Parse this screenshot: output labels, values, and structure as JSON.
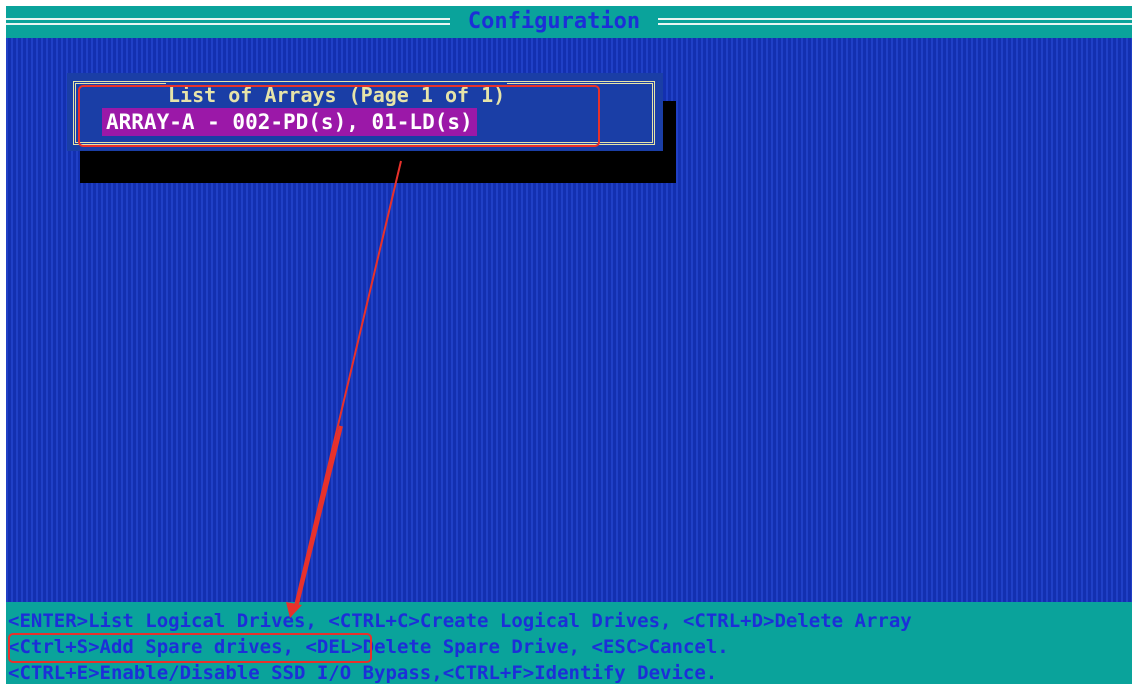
{
  "window": {
    "title": "Configuration"
  },
  "dialog": {
    "title": "List of Arrays (Page 1 of 1)",
    "items": [
      {
        "label": "ARRAY-A - 002-PD(s), 01-LD(s)",
        "selected": true
      }
    ]
  },
  "help": {
    "line1": [
      {
        "key": "<ENTER>",
        "action": "List Logical Drives,"
      },
      {
        "key": "<CTRL+C>",
        "action": "Create Logical Drives,"
      },
      {
        "key": "<CTRL+D>",
        "action": "Delete Array"
      }
    ],
    "line2": [
      {
        "key": "<Ctrl+S>",
        "action": "Add Spare drives,"
      },
      {
        "key": "<DEL>",
        "action": "Delete Spare Drive,"
      },
      {
        "key": "<ESC>",
        "action": "Cancel."
      }
    ],
    "line3": [
      {
        "key": "<CTRL+E>",
        "action": "Enable/Disable SSD I/O Bypass,"
      },
      {
        "key": "<CTRL+F>",
        "action": "Identify Device."
      }
    ]
  },
  "colors": {
    "title_bar": "#0aa39b",
    "background": "#1533b8",
    "highlight": "#9b18a8",
    "frame": "#e6e4a8",
    "text_on_teal": "#1c2fd8",
    "annotation": "#e8312b"
  },
  "annotations": [
    {
      "type": "box",
      "target": "array-item"
    },
    {
      "type": "box",
      "target": "ctrl-s-hotkey"
    },
    {
      "type": "arrow",
      "from": "array-item",
      "to": "ctrl-s-hotkey"
    }
  ]
}
